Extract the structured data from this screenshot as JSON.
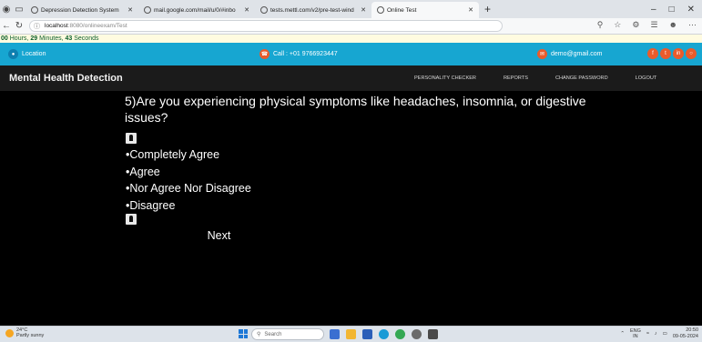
{
  "browser": {
    "tabs": [
      {
        "label": "Depression Detection System",
        "active": false
      },
      {
        "label": "mail.google.com/mail/u/0/#inbo",
        "active": false
      },
      {
        "label": "tests.mettl.com/v2/pre-test-wind",
        "active": false
      },
      {
        "label": "Online Test",
        "active": true
      }
    ],
    "url_host": "localhost",
    "url_path": ":8080/onlineexam/Test"
  },
  "timer": {
    "hours": "00",
    "hours_label": "Hours,",
    "minutes": "29",
    "minutes_label": "Minutes,",
    "seconds": "43",
    "seconds_label": "Seconds"
  },
  "topbar": {
    "location": "Location",
    "call": "Call : +01 9766923447",
    "email": "demo@gmail.com",
    "social_icons": [
      "facebook-icon",
      "twitter-icon",
      "linkedin-icon",
      "instagram-icon"
    ],
    "accent_color": "#17a6d1",
    "social_color": "#ea5b2b"
  },
  "header": {
    "brand": "Mental Health Detection",
    "menu": [
      "PERSONALITY CHECKER",
      "REPORTS",
      "CHANGE PASSWORD",
      "LOGOUT"
    ]
  },
  "quiz": {
    "question": "5)Are you experiencing physical symptoms like headaches, insomnia, or digestive issues?",
    "options": [
      "•Completely Agree",
      "•Agree",
      "•Nor Agree Nor Disagree",
      "•Disagree"
    ],
    "next_label": "Next"
  },
  "taskbar": {
    "temp": "24°C",
    "weather": "Partly sunny",
    "search_placeholder": "Search",
    "lang": "ENG",
    "region": "IN",
    "time": "20:50",
    "date": "09-05-2024"
  }
}
